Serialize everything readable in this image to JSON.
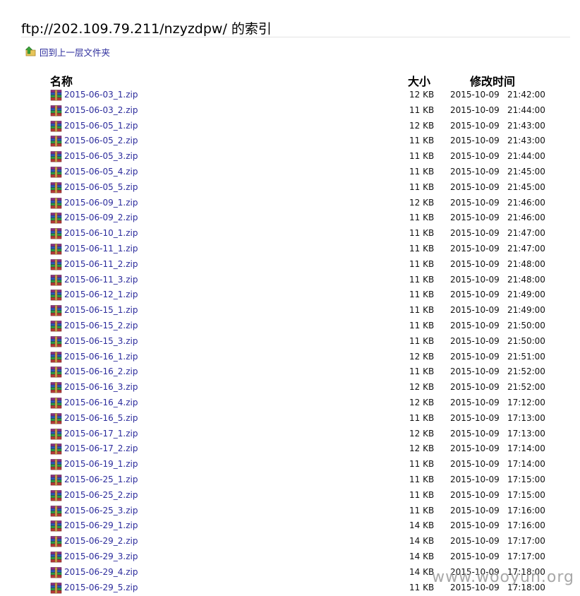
{
  "page": {
    "title": "ftp://202.109.79.211/nzyzdpw/ 的索引",
    "up_link_label": "回到上一层文件夹"
  },
  "columns": {
    "name": "名称",
    "size": "大小",
    "modified": "修改时间"
  },
  "icons": {
    "up": "folder-up-icon",
    "file": "winrar-archive-icon"
  },
  "colors": {
    "link": "#2c2c9c",
    "text": "#111111"
  },
  "files": [
    {
      "name": "2015-06-03_1.zip",
      "size": "12 KB",
      "date": "2015-10-09",
      "time": "21:42:00"
    },
    {
      "name": "2015-06-03_2.zip",
      "size": "11 KB",
      "date": "2015-10-09",
      "time": "21:44:00"
    },
    {
      "name": "2015-06-05_1.zip",
      "size": "12 KB",
      "date": "2015-10-09",
      "time": "21:43:00"
    },
    {
      "name": "2015-06-05_2.zip",
      "size": "11 KB",
      "date": "2015-10-09",
      "time": "21:43:00"
    },
    {
      "name": "2015-06-05_3.zip",
      "size": "11 KB",
      "date": "2015-10-09",
      "time": "21:44:00"
    },
    {
      "name": "2015-06-05_4.zip",
      "size": "11 KB",
      "date": "2015-10-09",
      "time": "21:45:00"
    },
    {
      "name": "2015-06-05_5.zip",
      "size": "11 KB",
      "date": "2015-10-09",
      "time": "21:45:00"
    },
    {
      "name": "2015-06-09_1.zip",
      "size": "12 KB",
      "date": "2015-10-09",
      "time": "21:46:00"
    },
    {
      "name": "2015-06-09_2.zip",
      "size": "11 KB",
      "date": "2015-10-09",
      "time": "21:46:00"
    },
    {
      "name": "2015-06-10_1.zip",
      "size": "11 KB",
      "date": "2015-10-09",
      "time": "21:47:00"
    },
    {
      "name": "2015-06-11_1.zip",
      "size": "11 KB",
      "date": "2015-10-09",
      "time": "21:47:00"
    },
    {
      "name": "2015-06-11_2.zip",
      "size": "11 KB",
      "date": "2015-10-09",
      "time": "21:48:00"
    },
    {
      "name": "2015-06-11_3.zip",
      "size": "11 KB",
      "date": "2015-10-09",
      "time": "21:48:00"
    },
    {
      "name": "2015-06-12_1.zip",
      "size": "11 KB",
      "date": "2015-10-09",
      "time": "21:49:00"
    },
    {
      "name": "2015-06-15_1.zip",
      "size": "11 KB",
      "date": "2015-10-09",
      "time": "21:49:00"
    },
    {
      "name": "2015-06-15_2.zip",
      "size": "11 KB",
      "date": "2015-10-09",
      "time": "21:50:00"
    },
    {
      "name": "2015-06-15_3.zip",
      "size": "11 KB",
      "date": "2015-10-09",
      "time": "21:50:00"
    },
    {
      "name": "2015-06-16_1.zip",
      "size": "12 KB",
      "date": "2015-10-09",
      "time": "21:51:00"
    },
    {
      "name": "2015-06-16_2.zip",
      "size": "11 KB",
      "date": "2015-10-09",
      "time": "21:52:00"
    },
    {
      "name": "2015-06-16_3.zip",
      "size": "12 KB",
      "date": "2015-10-09",
      "time": "21:52:00"
    },
    {
      "name": "2015-06-16_4.zip",
      "size": "12 KB",
      "date": "2015-10-09",
      "time": "17:12:00"
    },
    {
      "name": "2015-06-16_5.zip",
      "size": "11 KB",
      "date": "2015-10-09",
      "time": "17:13:00"
    },
    {
      "name": "2015-06-17_1.zip",
      "size": "12 KB",
      "date": "2015-10-09",
      "time": "17:13:00"
    },
    {
      "name": "2015-06-17_2.zip",
      "size": "12 KB",
      "date": "2015-10-09",
      "time": "17:14:00"
    },
    {
      "name": "2015-06-19_1.zip",
      "size": "11 KB",
      "date": "2015-10-09",
      "time": "17:14:00"
    },
    {
      "name": "2015-06-25_1.zip",
      "size": "11 KB",
      "date": "2015-10-09",
      "time": "17:15:00"
    },
    {
      "name": "2015-06-25_2.zip",
      "size": "11 KB",
      "date": "2015-10-09",
      "time": "17:15:00"
    },
    {
      "name": "2015-06-25_3.zip",
      "size": "11 KB",
      "date": "2015-10-09",
      "time": "17:16:00"
    },
    {
      "name": "2015-06-29_1.zip",
      "size": "14 KB",
      "date": "2015-10-09",
      "time": "17:16:00"
    },
    {
      "name": "2015-06-29_2.zip",
      "size": "14 KB",
      "date": "2015-10-09",
      "time": "17:17:00"
    },
    {
      "name": "2015-06-29_3.zip",
      "size": "14 KB",
      "date": "2015-10-09",
      "time": "17:17:00"
    },
    {
      "name": "2015-06-29_4.zip",
      "size": "14 KB",
      "date": "2015-10-09",
      "time": "17:18:00"
    },
    {
      "name": "2015-06-29_5.zip",
      "size": "11 KB",
      "date": "2015-10-09",
      "time": "17:18:00"
    }
  ],
  "watermark": "www.wooyun.org"
}
